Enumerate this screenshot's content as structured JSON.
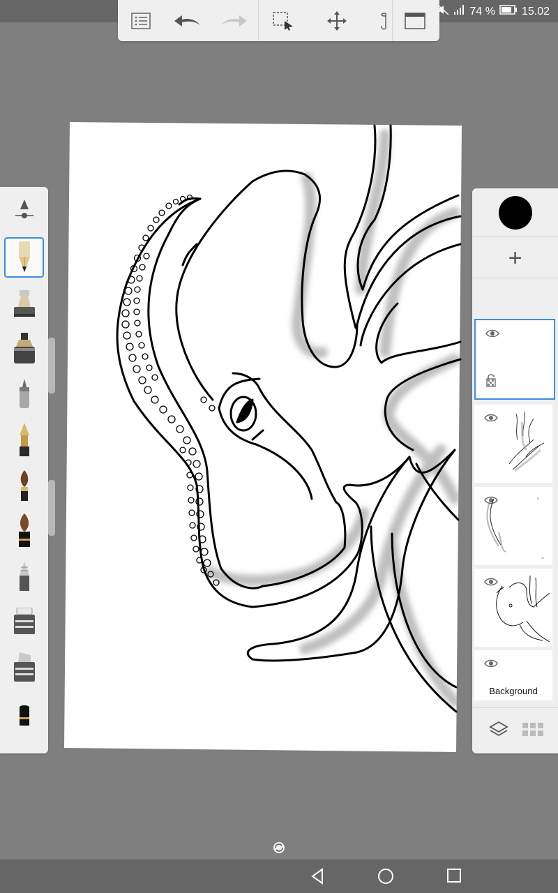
{
  "status_bar": {
    "battery_percent": "74 %",
    "time": "15.02",
    "icons": [
      "mute-icon",
      "signal-icon",
      "battery-icon"
    ]
  },
  "toolbar": {
    "buttons": [
      "menu-list-icon",
      "undo-icon",
      "redo-icon",
      "selection-icon",
      "move-transform-icon",
      "fill-bucket-icon",
      "fullscreen-icon"
    ]
  },
  "brush_palette": {
    "items": [
      "brush-size-slider-icon",
      "pencil-icon",
      "ballpoint-pen-icon",
      "marker-icon",
      "airbrush-icon",
      "fountain-pen-icon",
      "paint-brush-icon",
      "ink-brush-icon",
      "smudge-icon",
      "eraser-icon",
      "chisel-marker-icon",
      "flat-marker-icon",
      "eraser-2-icon"
    ],
    "selected_index": 1
  },
  "layers": {
    "color_swatch": "#000000",
    "add_label": "+",
    "items": [
      {
        "name": "layer-1",
        "label": "",
        "active": true,
        "locked": true
      },
      {
        "name": "layer-2",
        "label": "",
        "active": false
      },
      {
        "name": "layer-3",
        "label": "",
        "active": false
      },
      {
        "name": "layer-4",
        "label": "",
        "active": false
      },
      {
        "name": "background-layer",
        "label": "Background",
        "active": false
      }
    ],
    "footer_icons": [
      "layers-icon",
      "grid-icon"
    ]
  },
  "colors": {
    "accent": "#3b8de0",
    "workspace": "#7f7f7f",
    "panel": "#efefef"
  }
}
